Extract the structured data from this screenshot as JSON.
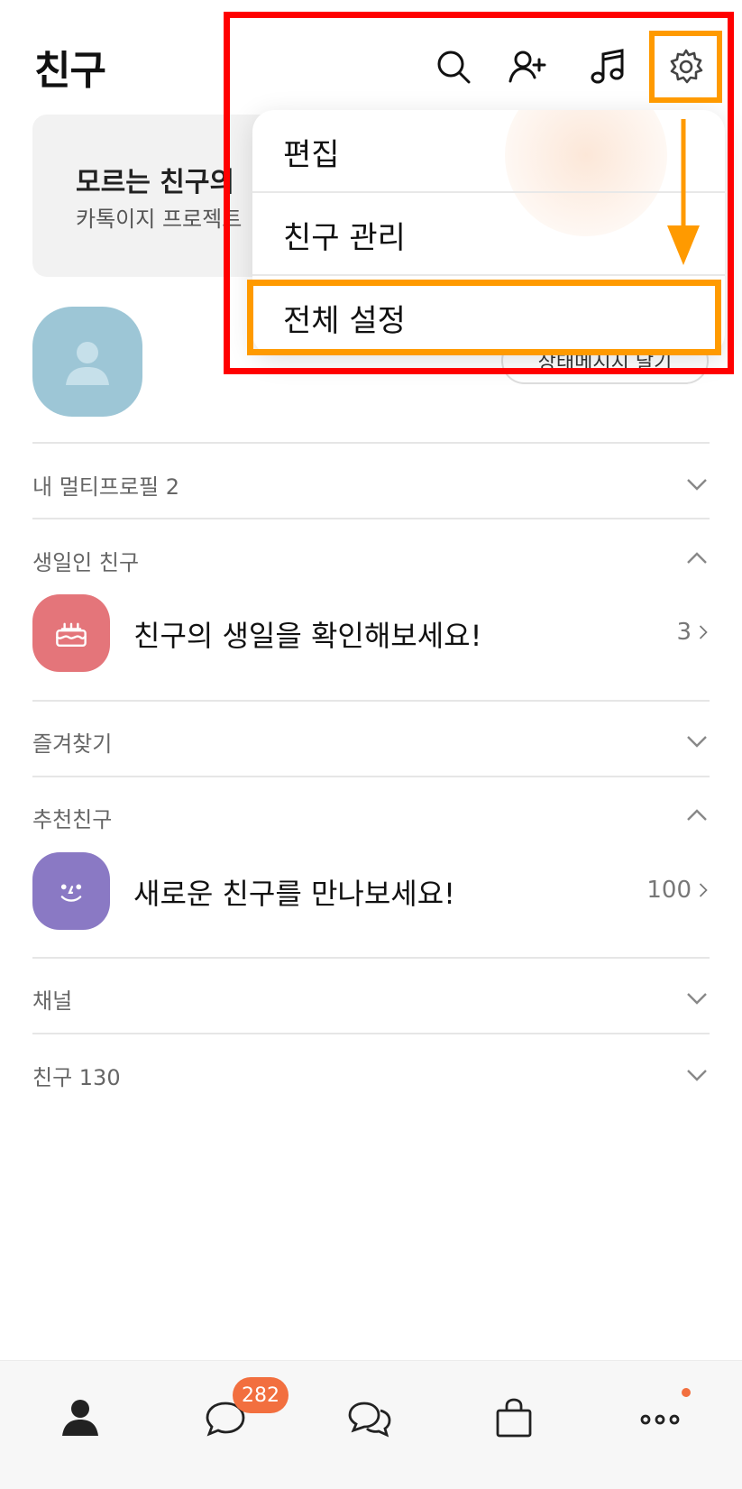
{
  "header": {
    "title": "친구",
    "icons": [
      "search-icon",
      "add-friend-icon",
      "music-icon",
      "settings-gear-icon"
    ]
  },
  "banner": {
    "title": "모르는 친구의",
    "subtitle": "카톡이지 프로젝트"
  },
  "profile": {
    "status_button": "상태메시지 달기"
  },
  "sections": {
    "multi_profile": "내 멀티프로필 2",
    "birthday": "생일인 친구",
    "birthday_item": "친구의 생일을 확인해보세요!",
    "birthday_count": "3",
    "favorites": "즐겨찾기",
    "recommended": "추천친구",
    "recommended_item": "새로운 친구를 만나보세요!",
    "recommended_count": "100",
    "channel": "채널",
    "friends": "친구 130"
  },
  "menu": {
    "items": [
      "편집",
      "친구 관리",
      "전체 설정"
    ]
  },
  "bottom_nav": {
    "chat_badge": "282",
    "icons": [
      "friends-icon",
      "chats-icon",
      "open-chat-icon",
      "shopping-icon",
      "more-icon"
    ]
  },
  "colors": {
    "birthday_icon_bg": "#e4757a",
    "recommend_icon_bg": "#8a79c4",
    "profile_bg": "#9dc6d6",
    "badge": "#f26f3f",
    "annotation_red": "#ff0000",
    "annotation_orange": "#ff9a00"
  }
}
